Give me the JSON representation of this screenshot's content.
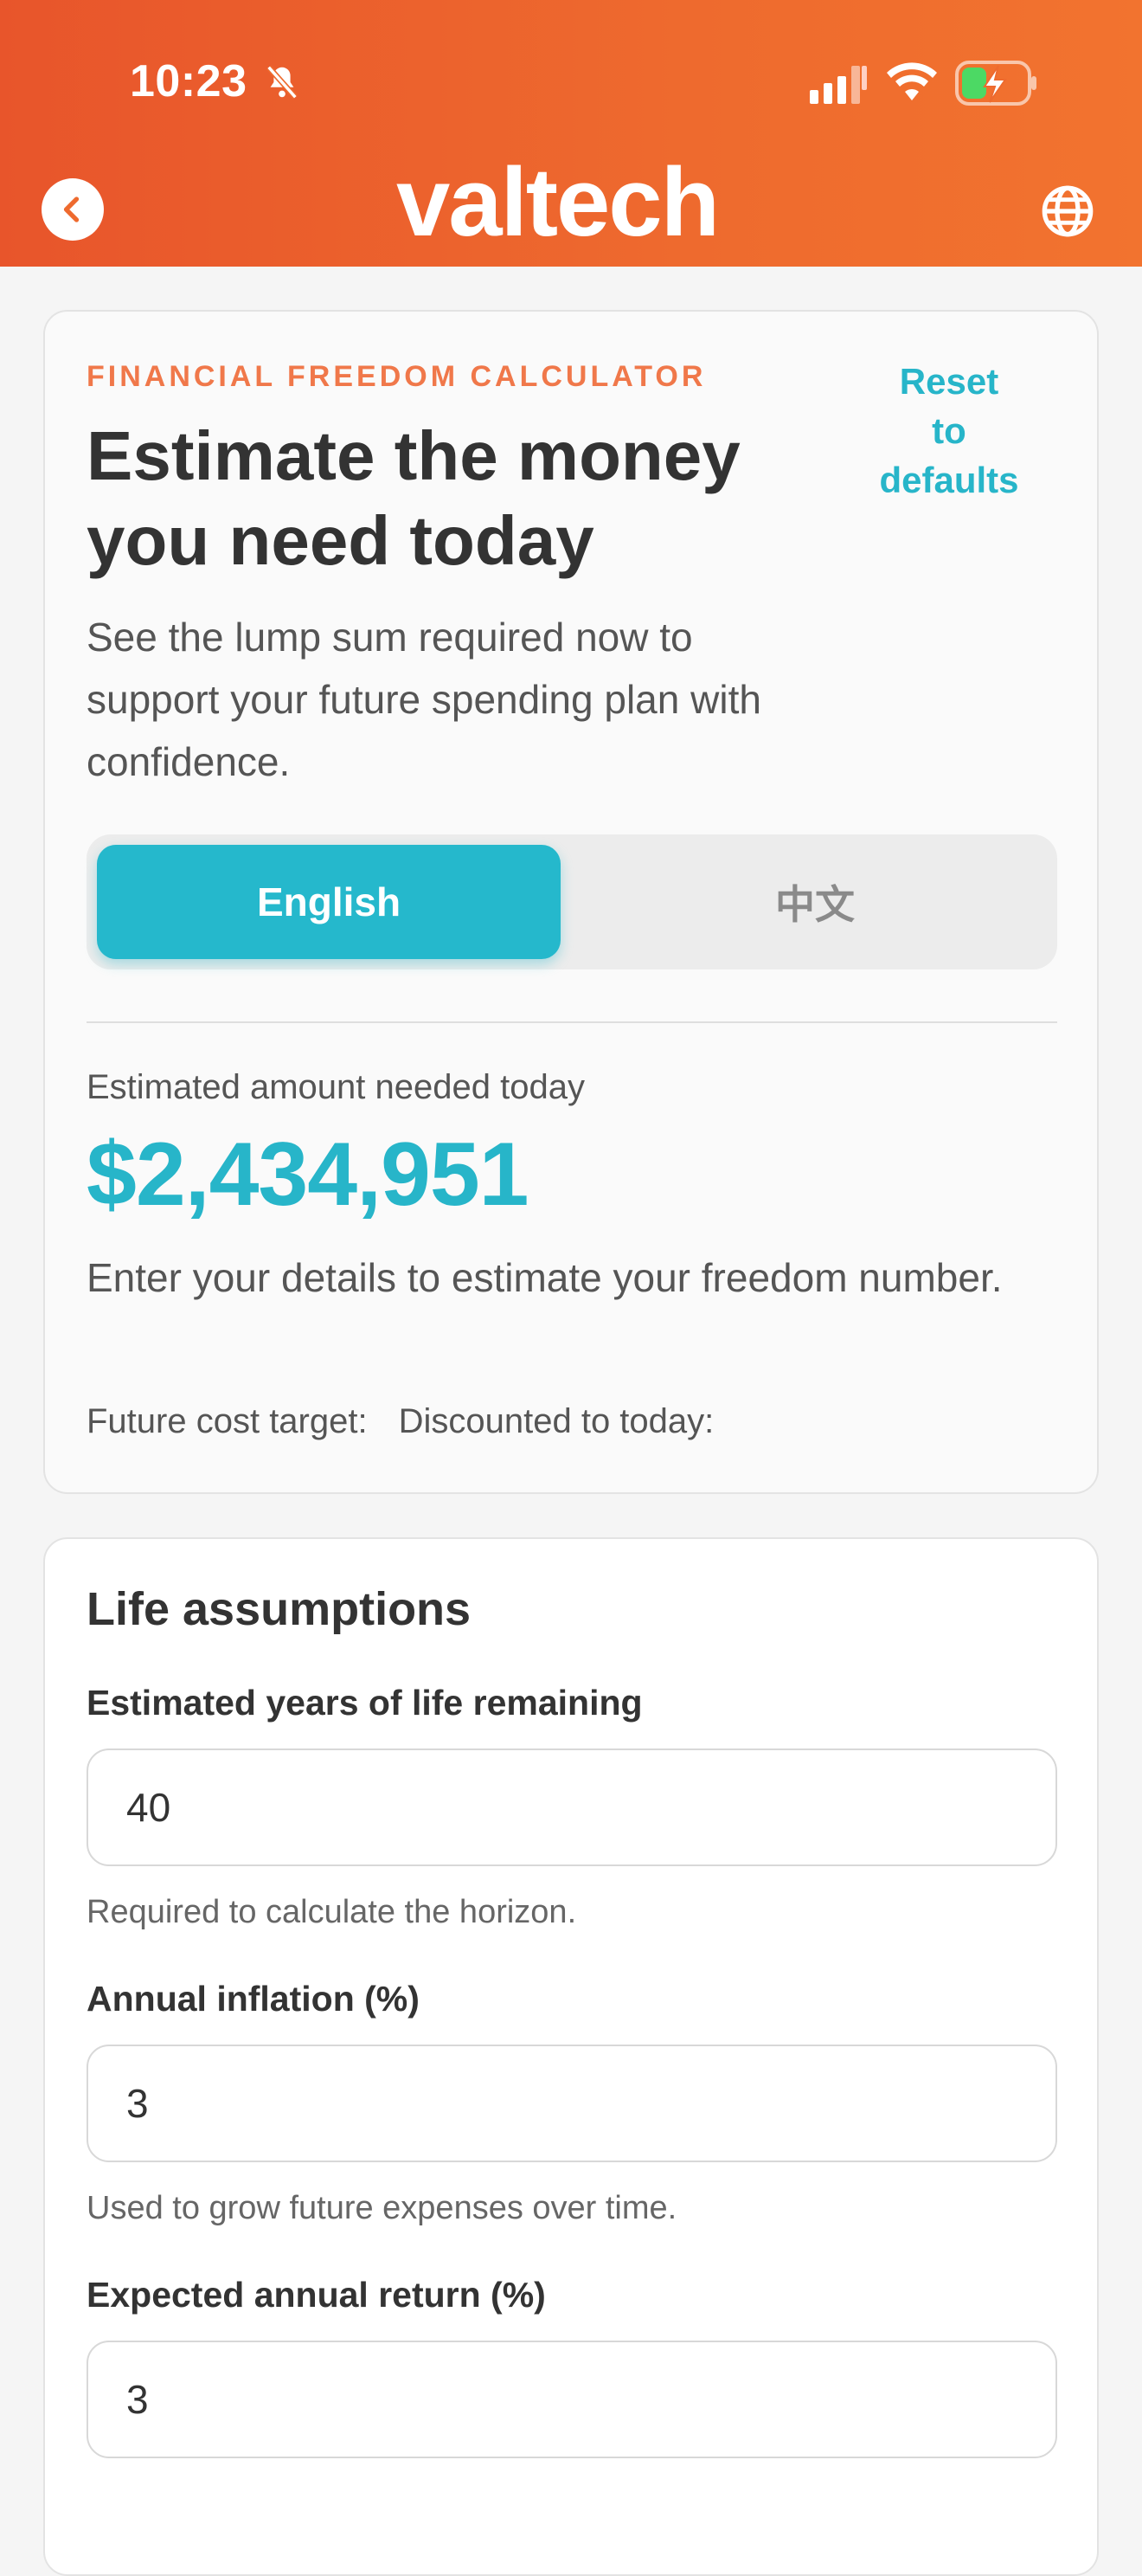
{
  "status_bar": {
    "time": "10:23"
  },
  "header": {
    "logo": "valtech"
  },
  "hero": {
    "eyebrow": "FINANCIAL FREEDOM CALCULATOR",
    "reset_label": [
      "Reset",
      "to",
      "defaults"
    ],
    "title": "Estimate the money you need today",
    "subtitle": "See the lump sum required now to support your future spending plan with confidence.",
    "languages": {
      "english": "English",
      "chinese": "中文",
      "selected": "English"
    },
    "estimate_label": "Estimated amount needed today",
    "estimate_value": "$2,434,951",
    "estimate_note": "Enter your details to estimate your freedom number.",
    "future_cost_label": "Future cost target:",
    "discounted_label": "Discounted to today:"
  },
  "life_assumptions": {
    "title": "Life assumptions",
    "fields": [
      {
        "label": "Estimated years of life remaining",
        "value": "40",
        "help": "Required to calculate the horizon."
      },
      {
        "label": "Annual inflation (%)",
        "value": "3",
        "help": "Used to grow future expenses over time."
      },
      {
        "label": "Expected annual return (%)",
        "value": "3",
        "help": ""
      }
    ]
  },
  "colors": {
    "header": "#ee6a2e",
    "accent": "#27b5c9",
    "eyebrow": "#f0784a"
  },
  "icons": [
    "bell-off-icon",
    "signal-icon",
    "wifi-icon",
    "battery-charging-icon",
    "back-chevron-icon",
    "globe-icon"
  ]
}
